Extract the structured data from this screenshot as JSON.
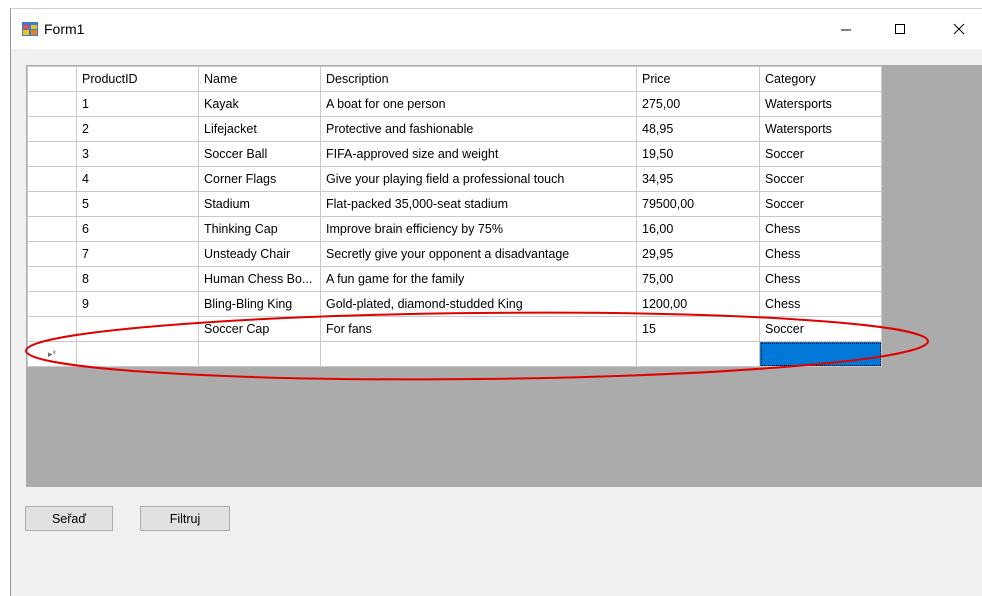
{
  "window": {
    "title": "Form1",
    "minimize_glyph": "—",
    "maximize_glyph": "☐",
    "close_glyph": "✕"
  },
  "grid": {
    "columns": [
      "ProductID",
      "Name",
      "Description",
      "Price",
      "Category"
    ],
    "rows": [
      {
        "id": "1",
        "name": "Kayak",
        "description": "A boat for one person",
        "price": "275,00",
        "category": "Watersports"
      },
      {
        "id": "2",
        "name": "Lifejacket",
        "description": "Protective and fashionable",
        "price": "48,95",
        "category": "Watersports"
      },
      {
        "id": "3",
        "name": "Soccer Ball",
        "description": "FIFA-approved size and weight",
        "price": "19,50",
        "category": "Soccer"
      },
      {
        "id": "4",
        "name": "Corner Flags",
        "description": "Give your playing field a professional touch",
        "price": "34,95",
        "category": "Soccer"
      },
      {
        "id": "5",
        "name": "Stadium",
        "description": "Flat-packed 35,000-seat stadium",
        "price": "79500,00",
        "category": "Soccer"
      },
      {
        "id": "6",
        "name": "Thinking Cap",
        "description": "Improve brain efficiency by 75%",
        "price": "16,00",
        "category": "Chess"
      },
      {
        "id": "7",
        "name": "Unsteady Chair",
        "description": "Secretly give your opponent a disadvantage",
        "price": "29,95",
        "category": "Chess"
      },
      {
        "id": "8",
        "name": "Human Chess Bo...",
        "description": "A fun game for the family",
        "price": "75,00",
        "category": "Chess"
      },
      {
        "id": "9",
        "name": "Bling-Bling King",
        "description": "Gold-plated, diamond-studded King",
        "price": "1200,00",
        "category": "Chess"
      },
      {
        "id": "",
        "name": "Soccer Cap",
        "description": "For fans",
        "price": "15",
        "category": "Soccer"
      }
    ],
    "new_row_marker": "▸*"
  },
  "buttons": {
    "sort_label": "Seřaď",
    "filter_label": "Filtruj"
  },
  "colors": {
    "selection": "#0078d7",
    "annotation": "#e00000",
    "grid_background": "#ababab"
  }
}
